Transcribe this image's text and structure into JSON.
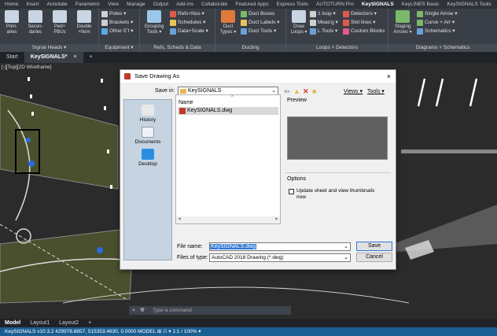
{
  "colors": {
    "ribbon": "#3a3f47",
    "drawing_bg": "#2b2b2b",
    "status_bar": "#1b5e91",
    "accent_selection": "#3079d6"
  },
  "ribbon_tabs": [
    "Home",
    "Insert",
    "Annotate",
    "Parametric",
    "View",
    "Manage",
    "Output",
    "Add-ins",
    "Collaborate",
    "Featured Apps",
    "Express Tools",
    "AUTOTURN Pro",
    "KeySIGNALS",
    "KeyLINES Basic",
    "KeySIGNALS Tools"
  ],
  "ribbon": {
    "signal_heads": {
      "title": "Signal Heads ▾",
      "primaries": "Prim-\naries",
      "secondaries": "Secon-\ndaries",
      "peds": "Ped+\nPBUs",
      "double": "Double\n+Item"
    },
    "equipment": {
      "title": "Equipment ▾",
      "poles": "Poles ▾",
      "brackets": "Brackets ▾",
      "other": "Other E't ▾"
    },
    "refs": {
      "title": "Refs, Scheds & Data",
      "grouping": "Grouping\nTools ▾",
      "refs_nos": "Refs+Nos ▾",
      "schedules": "Schedules ▾",
      "data_scale": "Data+Scale ▾"
    },
    "ducting": {
      "title": "Ducting",
      "duct_types": "Duct\nTypes ▾",
      "duct_boxes": "Duct Boxes",
      "duct_labels": "Duct Labels ▾",
      "duct_tools": "Duct Tools ▾"
    },
    "loops": {
      "title": "Loops + Detectors",
      "draw_loops": "Draw\nLoops ▾",
      "one_loop": "1 loop ▾",
      "meas_g": "Meas'g ▾",
      "l_tools": "L Tools ▾",
      "detectors": "Detectors ▾",
      "slot_lines": "Slot lines ▾",
      "custom_blocks": "Custom Blocks"
    },
    "diagrams": {
      "title": "Diagrams + Schematics",
      "staging": "Staging\nArrows ▾",
      "single_arrow": "Single Arrow ▾",
      "curve_arr": "Curve + Arr ▾",
      "schematics": "Schematics ▾"
    }
  },
  "file_tabs": {
    "start": "Start",
    "active": "KeySIGNALS*",
    "close": "×",
    "add": "+"
  },
  "viewport_label": "[-][Top][2D Wireframe]",
  "dialog": {
    "title": "Save Drawing As",
    "close": "×",
    "save_in_label": "Save in:",
    "save_in_value": "KeySIGNALS",
    "views": "Views ▾",
    "tools": "Tools ▾",
    "places": [
      "History",
      "Documents",
      "Desktop"
    ],
    "list_header": "Name",
    "file_item": "KeySIGNALS.dwg",
    "preview_label": "Preview",
    "options_label": "Options",
    "checkbox_label": "Update sheet and view thumbnails now",
    "file_name_label": "File name:",
    "file_name_value": "KeySIGNALS.dwg",
    "file_type_label": "Files of type:",
    "file_type_value": "AutoCAD 2018 Drawing (*.dwg)",
    "save_btn": "Save",
    "cancel_btn": "Cancel"
  },
  "command_placeholder": "Type a command",
  "layout_tabs": [
    "Model",
    "Layout1",
    "Layout2",
    "+"
  ],
  "status_bar": "KeySIGNALS v10.3.2   429976.8857, 515353.4630, 0.0000   MODEL   ⊞ ⁞⁞⁞ ▾   1:1 / 100% ▾"
}
